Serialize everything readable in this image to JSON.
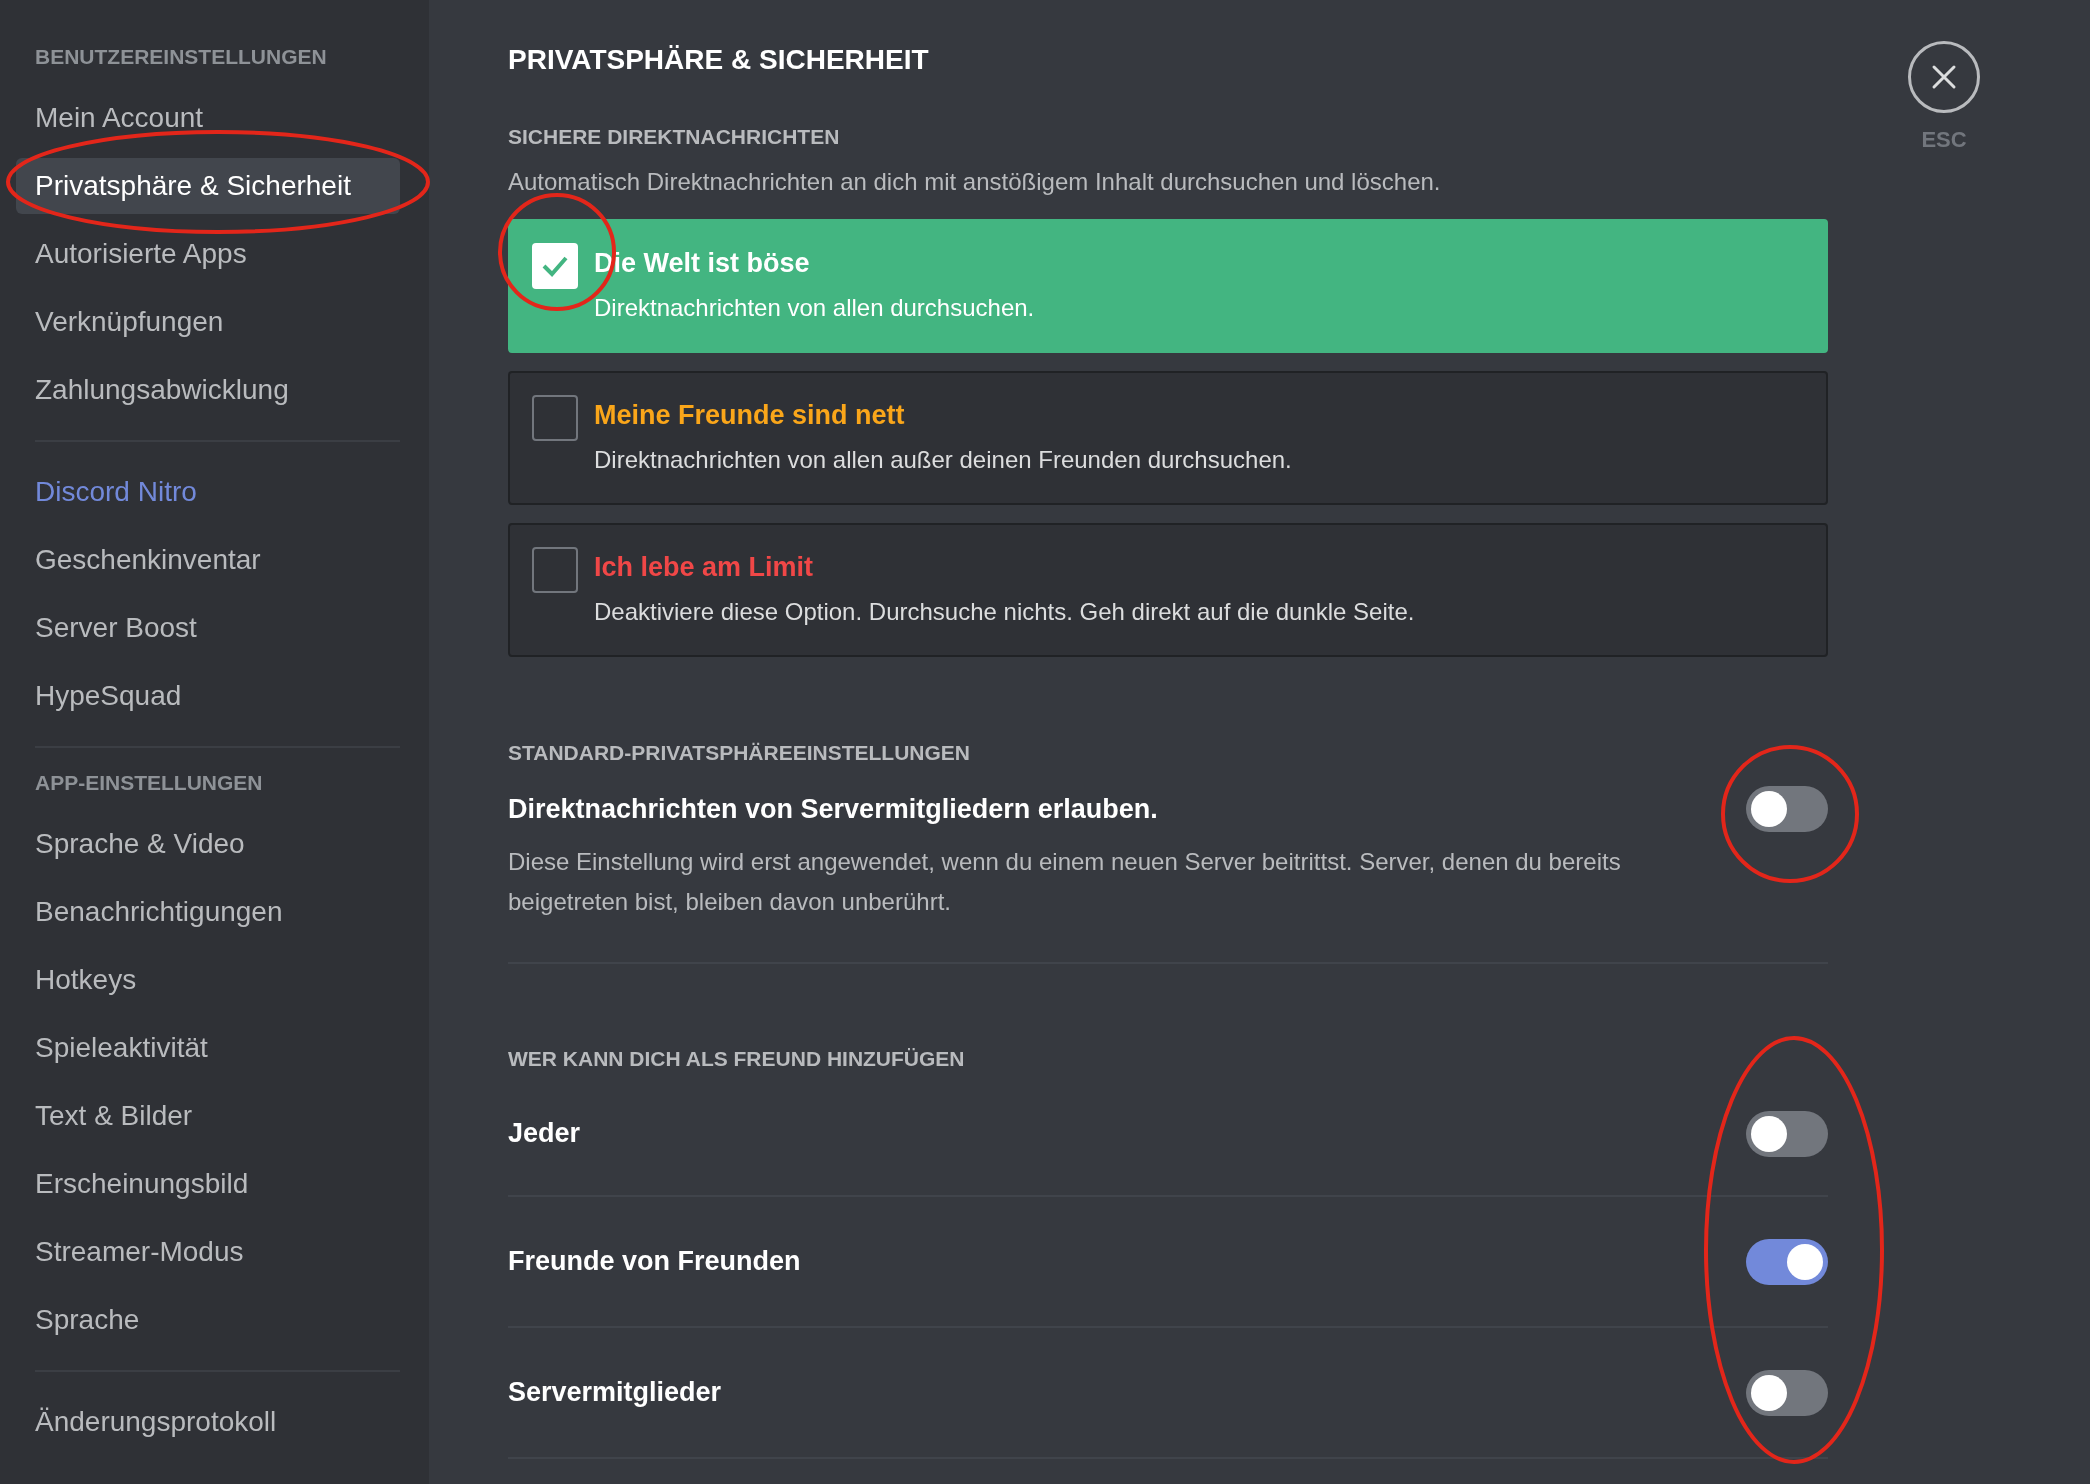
{
  "sidebar": {
    "sections": [
      {
        "header": "BENUTZEREINSTELLUNGEN",
        "items": [
          {
            "label": "Mein Account",
            "selected": false,
            "kind": "normal"
          },
          {
            "label": "Privatsphäre & Sicherheit",
            "selected": true,
            "kind": "normal"
          },
          {
            "label": "Autorisierte Apps",
            "selected": false,
            "kind": "normal"
          },
          {
            "label": "Verknüpfungen",
            "selected": false,
            "kind": "normal"
          },
          {
            "label": "Zahlungsabwicklung",
            "selected": false,
            "kind": "normal"
          }
        ]
      },
      {
        "items": [
          {
            "label": "Discord Nitro",
            "selected": false,
            "kind": "nitro"
          },
          {
            "label": "Geschenkinventar",
            "selected": false,
            "kind": "normal"
          },
          {
            "label": "Server Boost",
            "selected": false,
            "kind": "normal"
          },
          {
            "label": "HypeSquad",
            "selected": false,
            "kind": "normal"
          }
        ]
      },
      {
        "header": "APP-EINSTELLUNGEN",
        "items": [
          {
            "label": "Sprache & Video",
            "selected": false,
            "kind": "normal"
          },
          {
            "label": "Benachrichtigungen",
            "selected": false,
            "kind": "normal"
          },
          {
            "label": "Hotkeys",
            "selected": false,
            "kind": "normal"
          },
          {
            "label": "Spieleaktivität",
            "selected": false,
            "kind": "normal"
          },
          {
            "label": "Text & Bilder",
            "selected": false,
            "kind": "normal"
          },
          {
            "label": "Erscheinungsbild",
            "selected": false,
            "kind": "normal"
          },
          {
            "label": "Streamer-Modus",
            "selected": false,
            "kind": "normal"
          },
          {
            "label": "Sprache",
            "selected": false,
            "kind": "normal"
          }
        ]
      },
      {
        "items": [
          {
            "label": "Änderungsprotokoll",
            "selected": false,
            "kind": "normal"
          }
        ]
      }
    ]
  },
  "title": "PRIVATSPHÄRE & SICHERHEIT",
  "close": {
    "label": "ESC"
  },
  "dm_filter": {
    "header": "SICHERE DIREKTNACHRICHTEN",
    "description": "Automatisch Direktnachrichten an dich mit anstößigem Inhalt durchsuchen und löschen.",
    "options": [
      {
        "label": "Die Welt ist böse",
        "description": "Direktnachrichten von allen durchsuchen.",
        "selected": true,
        "color": "#ffffff"
      },
      {
        "label": "Meine Freunde sind nett",
        "description": "Direktnachrichten von allen außer deinen Freunden durchsuchen.",
        "selected": false,
        "color": "#faa61a"
      },
      {
        "label": "Ich lebe am Limit",
        "description": "Deaktiviere diese Option. Durchsuche nichts. Geh direkt auf die dunkle Seite.",
        "selected": false,
        "color": "#f04747"
      }
    ]
  },
  "server_dms": {
    "header": "STANDARD-PRIVATSPHÄREEINSTELLUNGEN",
    "label": "Direktnachrichten von Servermitgliedern erlauben.",
    "description": "Diese Einstellung wird erst angewendet, wenn du einem neuen Server beitrittst. Server, denen du bereits beigetreten bist, bleiben davon unberührt.",
    "on": false
  },
  "friend_requests": {
    "header": "WER KANN DICH ALS FREUND HINZUFÜGEN",
    "options": [
      {
        "label": "Jeder",
        "on": false
      },
      {
        "label": "Freunde von Freunden",
        "on": true
      },
      {
        "label": "Servermitglieder",
        "on": false
      }
    ]
  }
}
